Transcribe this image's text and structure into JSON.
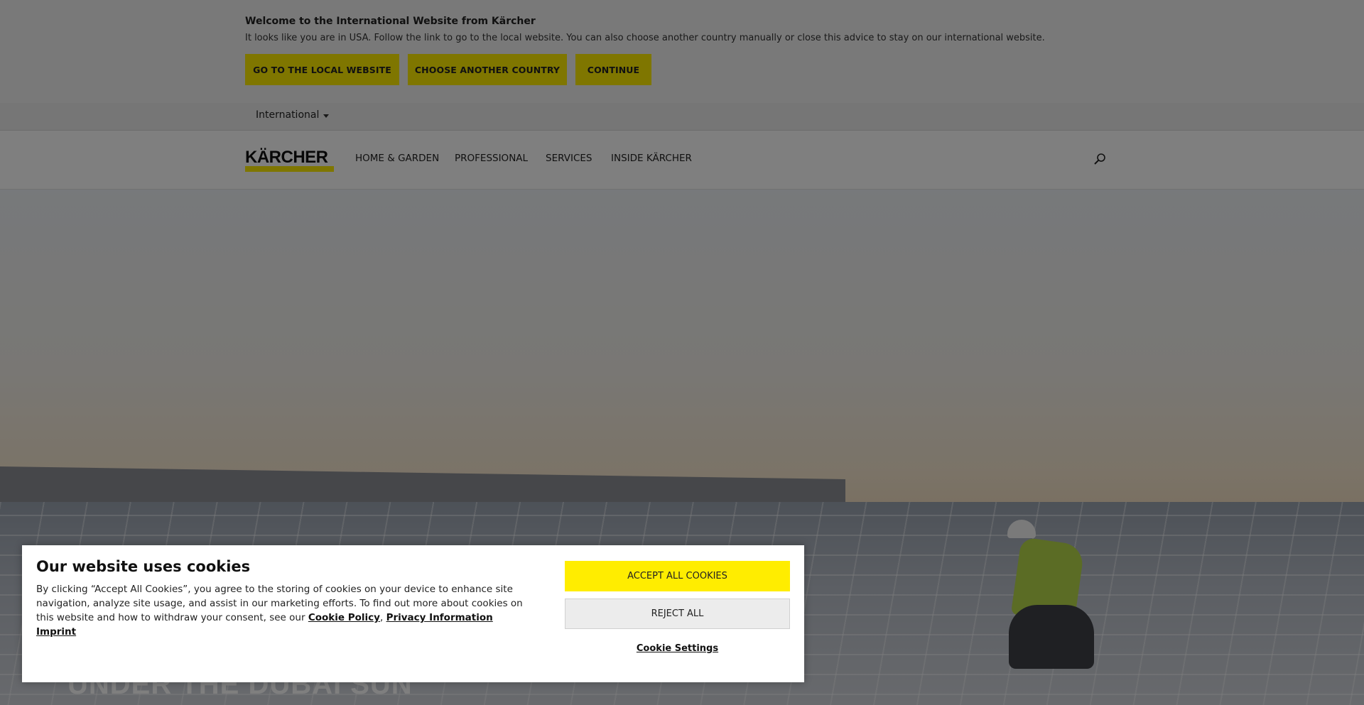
{
  "banner": {
    "title": "Welcome to the International Website from Kärcher",
    "text": "It looks like you are in USA. Follow the link to go to the local website. You can also choose another country manually or close this advice to stay on our international website.",
    "buttons": {
      "local": "GO TO THE LOCAL WEBSITE",
      "country": "CHOOSE ANOTHER COUNTRY",
      "continue": "CONTINUE"
    }
  },
  "country_selector": {
    "label": "International"
  },
  "header": {
    "logo_text": "KÄRCHER",
    "nav": [
      "HOME & GARDEN",
      "PROFESSIONAL",
      "SERVICES",
      "INSIDE KÄRCHER"
    ]
  },
  "hero": {
    "headline": "UNDER THE DUBAI SUN"
  },
  "cookie": {
    "title": "Our website uses cookies",
    "text": "By clicking “Accept All Cookies”, you agree to the storing of cookies on your device to enhance site navigation, analyze site usage, and assist in our marketing efforts. To find out more about cookies on this website and how to withdraw your consent, see our",
    "links": {
      "policy": "Cookie Policy",
      "separator": ",",
      "privacy": "Privacy Information",
      "imprint": "Imprint"
    },
    "accept": "ACCEPT ALL COOKIES",
    "reject": "REJECT ALL",
    "settings": "Cookie Settings"
  },
  "colors": {
    "brand_yellow": "#ffed00",
    "overlay": "rgba(0,0,0,0.5)"
  }
}
